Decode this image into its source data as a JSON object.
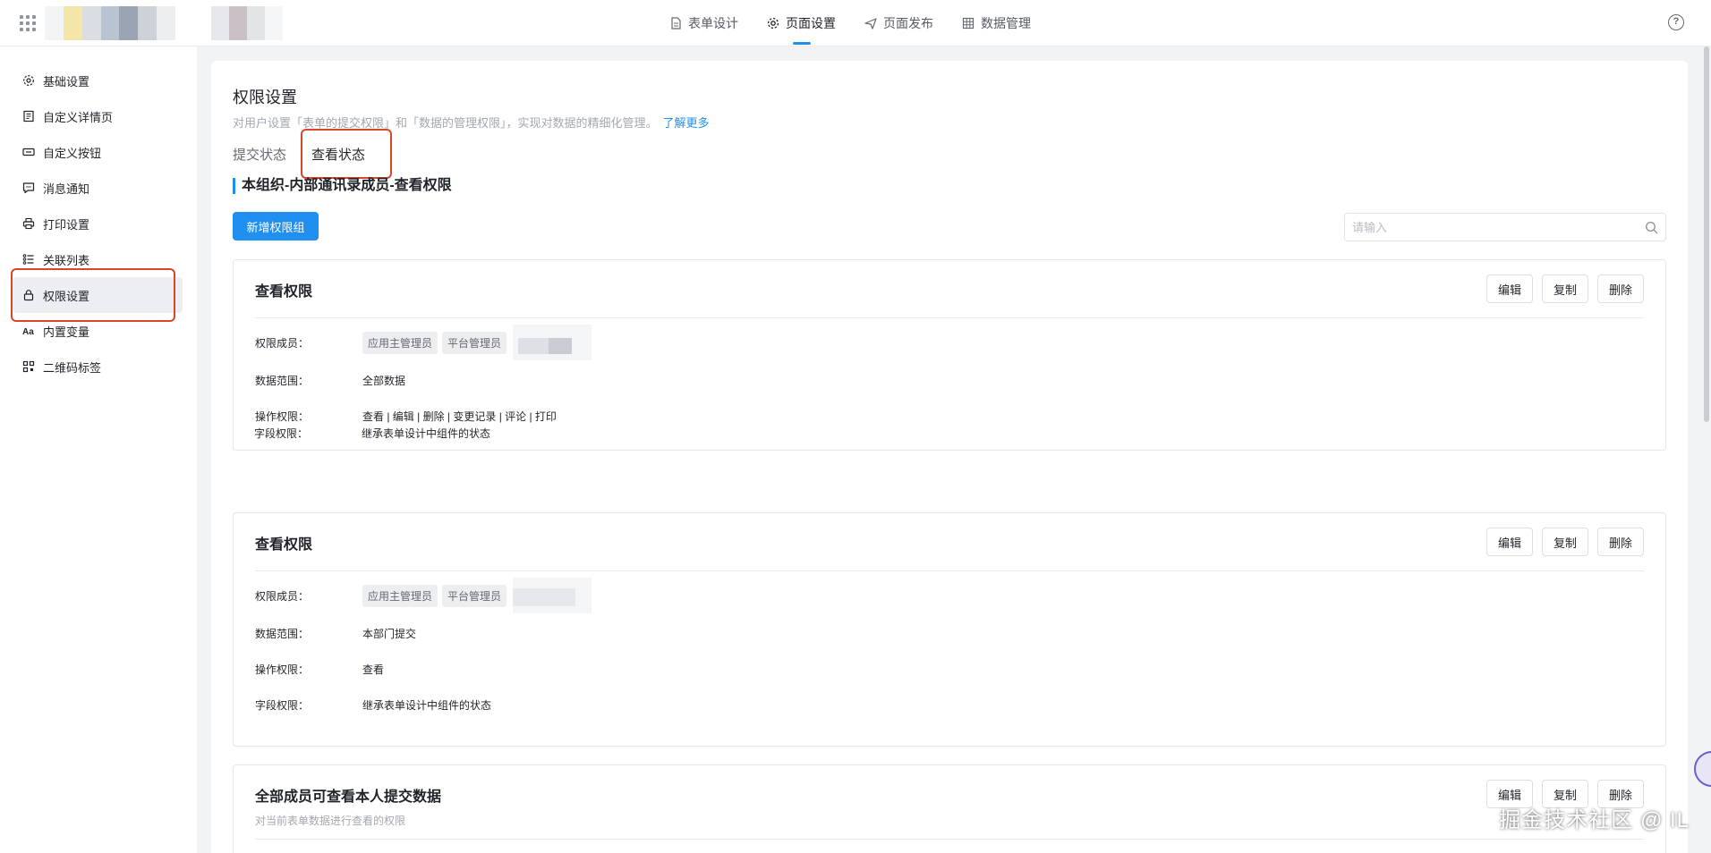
{
  "header": {
    "nav": [
      {
        "label": "表单设计",
        "icon": "document-icon",
        "active": false
      },
      {
        "label": "页面设置",
        "icon": "gear-icon",
        "active": true
      },
      {
        "label": "页面发布",
        "icon": "send-icon",
        "active": false
      },
      {
        "label": "数据管理",
        "icon": "table-icon",
        "active": false
      }
    ],
    "help": "?"
  },
  "sidebar": {
    "items": [
      {
        "label": "基础设置",
        "icon": "gear-icon"
      },
      {
        "label": "自定义详情页",
        "icon": "page-icon"
      },
      {
        "label": "自定义按钮",
        "icon": "button-icon"
      },
      {
        "label": "消息通知",
        "icon": "message-icon"
      },
      {
        "label": "打印设置",
        "icon": "printer-icon"
      },
      {
        "label": "关联列表",
        "icon": "list-icon"
      },
      {
        "label": "权限设置",
        "icon": "lock-icon",
        "active": true
      },
      {
        "label": "内置变量",
        "icon": "text-icon"
      },
      {
        "label": "二维码标签",
        "icon": "qrcode-icon"
      }
    ]
  },
  "main": {
    "title": "权限设置",
    "description": "对用户设置「表单的提交权限」和「数据的管理权限」，实现对数据的精细化管理。",
    "learn_more": "了解更多",
    "tabs": [
      {
        "label": "提交状态",
        "active": false
      },
      {
        "label": "查看状态",
        "active": true
      }
    ],
    "section_title": "本组织-内部通讯录成员-查看权限",
    "add_button": "新增权限组",
    "search_placeholder": "请输入",
    "labels": {
      "members": "权限成员：",
      "range": "数据范围：",
      "ops": "操作权限：",
      "fields": "字段权限："
    },
    "actions": {
      "edit": "编辑",
      "copy": "复制",
      "delete": "删除"
    },
    "groups": [
      {
        "title": "查看权限",
        "members": [
          "应用主管理员",
          "平台管理员"
        ],
        "range": "全部数据",
        "ops": "查看 | 编辑 | 删除 | 变更记录 | 评论 | 打印",
        "fields": "继承表单设计中组件的状态"
      },
      {
        "title": "查看权限",
        "members": [
          "应用主管理员",
          "平台管理员"
        ],
        "range": "本部门提交",
        "ops": "查看",
        "fields": "继承表单设计中组件的状态"
      },
      {
        "title": "全部成员可查看本人提交数据",
        "subtitle": "对当前表单数据进行查看的权限"
      }
    ]
  },
  "watermark": "掘金技术社区 @ IL",
  "colors": {
    "accent": "#1f8ff0",
    "highlight_box": "#d9472b"
  }
}
